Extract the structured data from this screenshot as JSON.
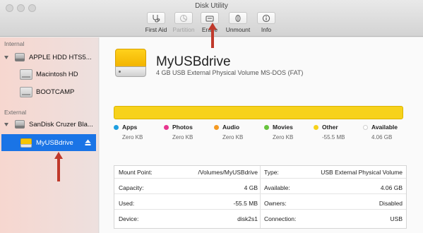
{
  "window": {
    "title": "Disk Utility"
  },
  "toolbar": {
    "items": [
      {
        "label": "First Aid",
        "icon": "stethoscope-icon",
        "enabled": true
      },
      {
        "label": "Partition",
        "icon": "pie-chart-icon",
        "enabled": false
      },
      {
        "label": "Erase",
        "icon": "erase-disk-icon",
        "enabled": true
      },
      {
        "label": "Unmount",
        "icon": "unmount-icon",
        "enabled": true
      },
      {
        "label": "Info",
        "icon": "info-icon",
        "enabled": true
      }
    ]
  },
  "sidebar": {
    "internal_header": "Internal",
    "external_header": "External",
    "internal_disk": "APPLE HDD HTS5...",
    "internal_volumes": [
      "Macintosh HD",
      "BOOTCAMP"
    ],
    "external_disk": "SanDisk Cruzer Bla...",
    "external_volume": "MyUSBdrive"
  },
  "volume": {
    "name": "MyUSBdrive",
    "description": "4 GB USB External Physical Volume MS-DOS (FAT)"
  },
  "usage": {
    "bar_color": "#f7d21b",
    "legend": [
      {
        "name": "Apps",
        "value": "Zero KB",
        "color": "#1e9fe0"
      },
      {
        "name": "Photos",
        "value": "Zero KB",
        "color": "#e8368f"
      },
      {
        "name": "Audio",
        "value": "Zero KB",
        "color": "#f59a22"
      },
      {
        "name": "Movies",
        "value": "Zero KB",
        "color": "#68c43d"
      },
      {
        "name": "Other",
        "value": "-55.5 MB",
        "color": "#f7d21b"
      },
      {
        "name": "Available",
        "value": "4.06 GB",
        "color": "#ffffff"
      }
    ]
  },
  "info": {
    "rows": [
      {
        "l_label": "Mount Point:",
        "l_value": "/Volumes/MyUSBdrive",
        "r_label": "Type:",
        "r_value": "USB External Physical Volume"
      },
      {
        "l_label": "Capacity:",
        "l_value": "4 GB",
        "r_label": "Available:",
        "r_value": "4.06 GB"
      },
      {
        "l_label": "Used:",
        "l_value": "-55.5 MB",
        "r_label": "Owners:",
        "r_value": "Disabled"
      },
      {
        "l_label": "Device:",
        "l_value": "disk2s1",
        "r_label": "Connection:",
        "r_value": "USB"
      }
    ]
  },
  "annotations": {
    "arrow_color": "#c0392b"
  }
}
